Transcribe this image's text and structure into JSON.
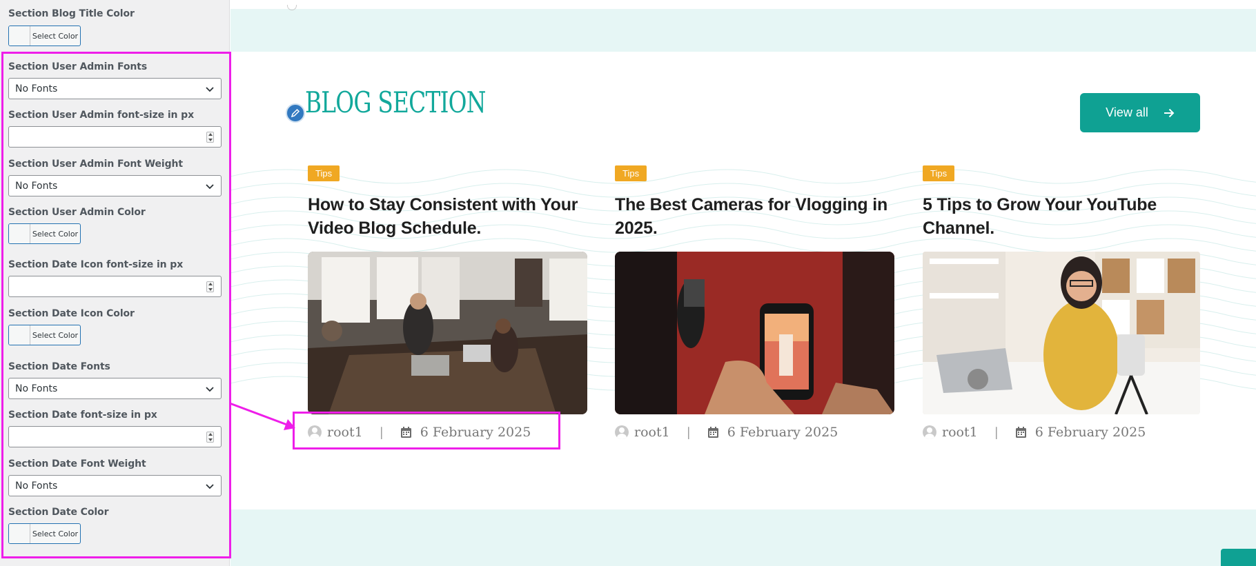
{
  "panel": {
    "fields": [
      {
        "label": "Section Blog Title Color",
        "button": "Select Color"
      },
      {
        "label": "Section User Admin Fonts",
        "value": "No Fonts"
      },
      {
        "label": "Section User Admin font-size in px",
        "value": ""
      },
      {
        "label": "Section User Admin Font Weight",
        "value": "No Fonts"
      },
      {
        "label": "Section User Admin Color",
        "button": "Select Color"
      },
      {
        "label": "Section Date Icon font-size in px",
        "value": ""
      },
      {
        "label": "Section Date Icon Color",
        "button": "Select Color"
      },
      {
        "label": "Section Date Fonts",
        "value": "No Fonts"
      },
      {
        "label": "Section Date font-size in px",
        "value": ""
      },
      {
        "label": "Section Date Font Weight",
        "value": "No Fonts"
      },
      {
        "label": "Section Date Color",
        "button": "Select Color"
      }
    ]
  },
  "main": {
    "section_title": "BLOG SECTION",
    "view_all": "View all",
    "cards": [
      {
        "tag": "Tips",
        "title": "How to Stay Consistent with Your Video Blog Schedule.",
        "author": "root1",
        "sep": "|",
        "date": "6 February 2025"
      },
      {
        "tag": "Tips",
        "title": "The Best Cameras for Vlogging in 2025.",
        "author": "root1",
        "sep": "|",
        "date": "6 February 2025"
      },
      {
        "tag": "Tips",
        "title": "5 Tips to Grow Your YouTube Channel.",
        "author": "root1",
        "sep": "|",
        "date": "6 February 2025"
      }
    ]
  },
  "colors": {
    "accent": "#0fa193",
    "tag": "#f0a823",
    "highlight": "#ee1ee9",
    "band": "#e6f6f5"
  }
}
